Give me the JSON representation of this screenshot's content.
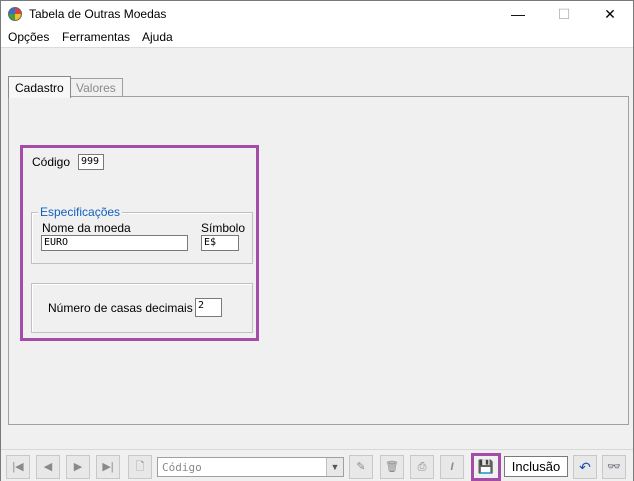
{
  "window": {
    "title": "Tabela de Outras Moedas",
    "minimize": "—",
    "maximize": "☐",
    "close": "✕"
  },
  "menu": {
    "opcoes": "Opções",
    "ferramentas": "Ferramentas",
    "ajuda": "Ajuda"
  },
  "tabs": {
    "cadastro": "Cadastro",
    "valores": "Valores"
  },
  "form": {
    "codigo_label": "Código",
    "codigo_value": "999",
    "especificacoes_legend": "Especificações",
    "nome_label": "Nome da moeda",
    "nome_value": "EURO",
    "simbolo_label": "Símbolo",
    "simbolo_value": "E$",
    "casas_label": "Número de casas decimais",
    "casas_value": "2"
  },
  "toolbar": {
    "first": "|◀",
    "prev": "◀",
    "next": "▶",
    "last": "▶|",
    "new_doc": "🗋",
    "search_combo": "Código",
    "combo_arrow": "▼",
    "edit": "✎",
    "delete": "🗑",
    "print": "⎙",
    "italic": "I",
    "save": "💾",
    "mode": "Inclusão",
    "undo": "↶",
    "find": "👓"
  },
  "colors": {
    "highlight": "#a34ca8",
    "legend": "#1060c0"
  }
}
